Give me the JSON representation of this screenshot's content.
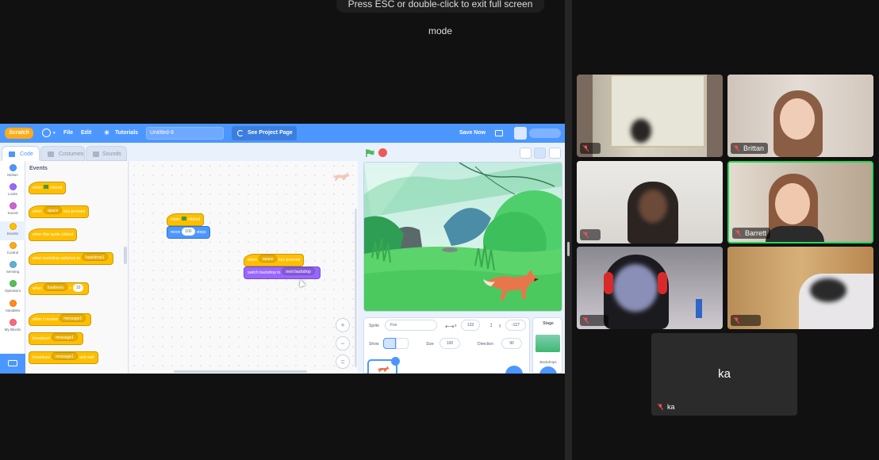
{
  "fullscreen_notice": "Press ESC or double-click to exit full screen mode",
  "scratch": {
    "logo": "Scratch",
    "menu": {
      "file": "File",
      "edit": "Edit",
      "tutorials": "Tutorials",
      "project_title": "Untitled-6",
      "see_project": "See Project Page",
      "save_now": "Save Now"
    },
    "tabs": {
      "code": "Code",
      "costumes": "Costumes",
      "sounds": "Sounds"
    },
    "categories": [
      "Motion",
      "Looks",
      "Sound",
      "Events",
      "Control",
      "Sensing",
      "Operators",
      "Variables",
      "My Blocks"
    ],
    "category_colors": [
      "#4c97ff",
      "#9966ff",
      "#cf63cf",
      "#ffbf00",
      "#ffab19",
      "#5cb1d6",
      "#59c059",
      "#ff8c1a",
      "#ff6680"
    ],
    "palette_heading": "Events",
    "palette_blocks": {
      "b1": {
        "pre": "when",
        "post": "clicked"
      },
      "b2": {
        "pre": "when",
        "dd": "space",
        "post": "key pressed"
      },
      "b3": {
        "text": "when this sprite clicked"
      },
      "b4": {
        "pre": "when backdrop switches to",
        "dd": "backdrop1"
      },
      "b5": {
        "pre": "when",
        "dd": "loudness",
        "mid": ">",
        "val": "10"
      },
      "b6": {
        "pre": "when I receive",
        "dd": "message1"
      },
      "b7": {
        "pre": "broadcast",
        "dd": "message1"
      },
      "b8": {
        "pre": "broadcast",
        "dd": "message1",
        "post": "and wait"
      }
    },
    "workspace_blocks": {
      "s1_hat": {
        "pre": "when",
        "post": "clicked"
      },
      "s1_move": {
        "pre": "move",
        "val": "100",
        "post": "steps"
      },
      "s2_hat": {
        "pre": "when",
        "dd": "space",
        "post": "key pressed"
      },
      "s2_switch": {
        "pre": "switch backdrop to",
        "dd": "next backdrop"
      }
    },
    "zoom": {
      "in": "+",
      "out": "−",
      "reset": "="
    },
    "sprite_info": {
      "sprite_label": "Sprite",
      "sprite_name": "Fox",
      "x_label": "x",
      "x": "133",
      "y_label": "y",
      "y": "-127",
      "show_label": "Show",
      "size_label": "Size",
      "size": "100",
      "direction_label": "Direction",
      "direction": "90"
    },
    "stage_pane": {
      "title": "Stage",
      "backdrops_label": "Backdrops"
    }
  },
  "participants": [
    {
      "name": "",
      "muted": true
    },
    {
      "name": "Brittan",
      "muted": true
    },
    {
      "name": "",
      "muted": true
    },
    {
      "name": "Barrett",
      "muted": true,
      "speaking": true
    },
    {
      "name": "",
      "muted": true
    },
    {
      "name": "",
      "muted": true
    },
    {
      "name": "ka",
      "muted": true,
      "no_video_label": "ka"
    }
  ]
}
